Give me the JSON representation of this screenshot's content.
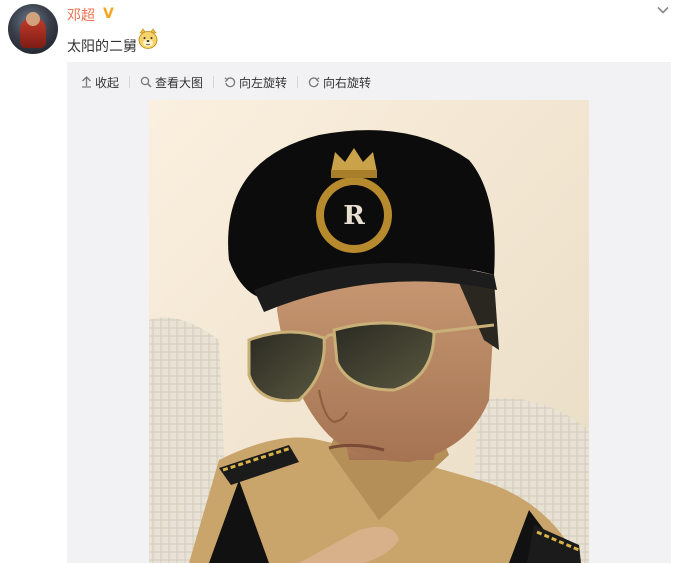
{
  "post": {
    "author": "邓超",
    "verified_badge": "V",
    "text": "太阳的二舅",
    "emoji": "doge-emoji"
  },
  "toolbar": {
    "collapse_label": "收起",
    "view_large_label": "查看大图",
    "rotate_left_label": "向左旋转",
    "rotate_right_label": "向右旋转"
  },
  "icons": {
    "collapse": "collapse-up-icon",
    "view_large": "magnifier-icon",
    "rotate_left": "rotate-left-icon",
    "rotate_right": "rotate-right-icon",
    "menu": "chevron-down-icon"
  },
  "photo": {
    "subject": "selfie in black beret with crown R badge, aviator sunglasses, khaki uniform"
  },
  "colors": {
    "accent": "#eb7350",
    "badge": "#f5a623",
    "panel_bg": "#f2f2f5"
  }
}
